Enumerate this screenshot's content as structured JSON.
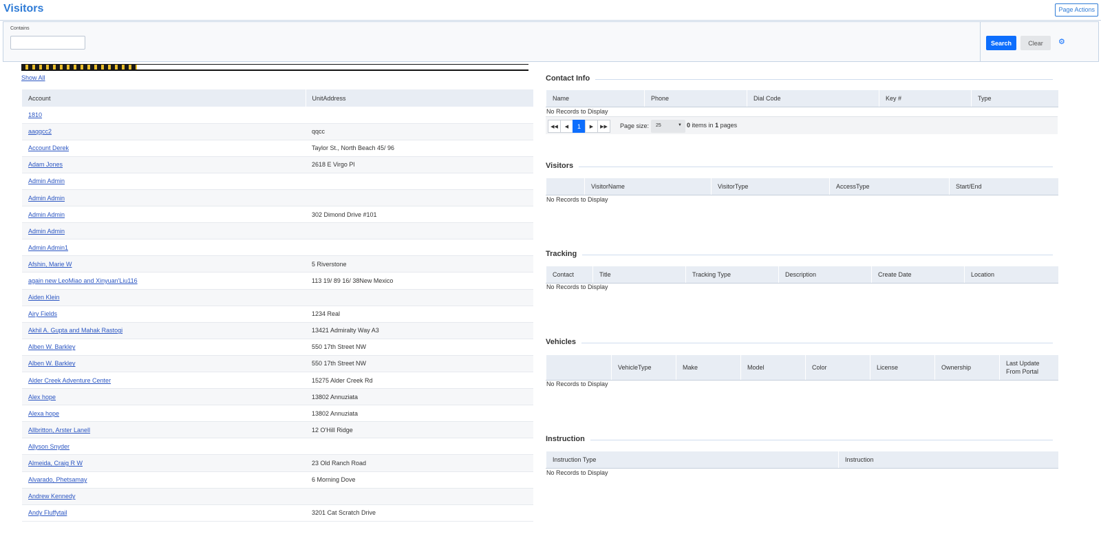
{
  "page": {
    "title": "Visitors",
    "page_actions_label": "Page Actions"
  },
  "search": {
    "contains_label": "Contains",
    "contains_value": "",
    "search_label": "Search",
    "clear_label": "Clear"
  },
  "accounts": {
    "show_all_label": "Show All",
    "columns": [
      "Account",
      "UnitAddress"
    ],
    "rows": [
      {
        "account": "1810",
        "address": ""
      },
      {
        "account": "aaqqcc2",
        "address": "qqcc"
      },
      {
        "account": "Account Derek",
        "address": "Taylor St., North Beach 45/ 96"
      },
      {
        "account": "Adam Jones",
        "address": "2618 E Virgo Pl"
      },
      {
        "account": "Admin Admin",
        "address": ""
      },
      {
        "account": "Admin Admin",
        "address": ""
      },
      {
        "account": "Admin Admin",
        "address": "302 Dimond Drive #101"
      },
      {
        "account": "Admin Admin",
        "address": ""
      },
      {
        "account": "Admin Admin1",
        "address": ""
      },
      {
        "account": "Afshin, Marie W",
        "address": "5 Riverstone"
      },
      {
        "account": "again new LeoMiao and Xinyuan'Liu116",
        "address": "113 19/ 89 16/ 38New Mexico"
      },
      {
        "account": "Aiden Klein",
        "address": ""
      },
      {
        "account": "Airy Fields",
        "address": "1234 Real"
      },
      {
        "account": "Akhil A. Gupta and Mahak Rastogi",
        "address": "13421 Admiralty Way A3"
      },
      {
        "account": "Alben W. Barkley",
        "address": "550 17th Street NW"
      },
      {
        "account": "Alben W. Barkley",
        "address": "550 17th Street NW"
      },
      {
        "account": "Alder Creek Adventure Center",
        "address": "15275 Alder Creek Rd"
      },
      {
        "account": "Alex hope",
        "address": "13802 Annuziata"
      },
      {
        "account": "Alexa hope",
        "address": "13802 Annuziata"
      },
      {
        "account": "Allbritton, Arster Lanell",
        "address": "12 O'Hill Ridge"
      },
      {
        "account": "Allyson Snyder",
        "address": ""
      },
      {
        "account": "Almeida, Craig R W",
        "address": "23 Old Ranch Road"
      },
      {
        "account": "Alvarado, Phetsamay",
        "address": "6 Morning Dove"
      },
      {
        "account": "Andrew Kennedy",
        "address": ""
      },
      {
        "account": "Andy Fluffytail",
        "address": "3201 Cat Scratch Drive"
      }
    ]
  },
  "contact_info": {
    "title": "Contact Info",
    "columns": [
      "Name",
      "Phone",
      "Dial Code",
      "Key #",
      "Type"
    ],
    "empty_text": "No Records to Display",
    "pager": {
      "current_page": "1",
      "page_size_label": "Page size:",
      "page_size": "25",
      "item_count": "0",
      "items_in_text": "items in",
      "page_count": "1",
      "pages_text": "pages"
    }
  },
  "visitors": {
    "title": "Visitors",
    "columns": [
      "",
      "VisitorName",
      "VisitorType",
      "AccessType",
      "Start/End"
    ],
    "empty_text": "No Records to Display"
  },
  "tracking": {
    "title": "Tracking",
    "columns": [
      "Contact",
      "Title",
      "Tracking Type",
      "Description",
      "Create Date",
      "Location"
    ],
    "empty_text": "No Records to Display"
  },
  "vehicles": {
    "title": "Vehicles",
    "columns": [
      "",
      "VehicleType",
      "Make",
      "Model",
      "Color",
      "License",
      "Ownership",
      "Last Update From Portal"
    ],
    "empty_text": "No Records to Display"
  },
  "instruction": {
    "title": "Instruction",
    "columns": [
      "Instruction Type",
      "Instruction"
    ],
    "empty_text": "No Records to Display"
  }
}
